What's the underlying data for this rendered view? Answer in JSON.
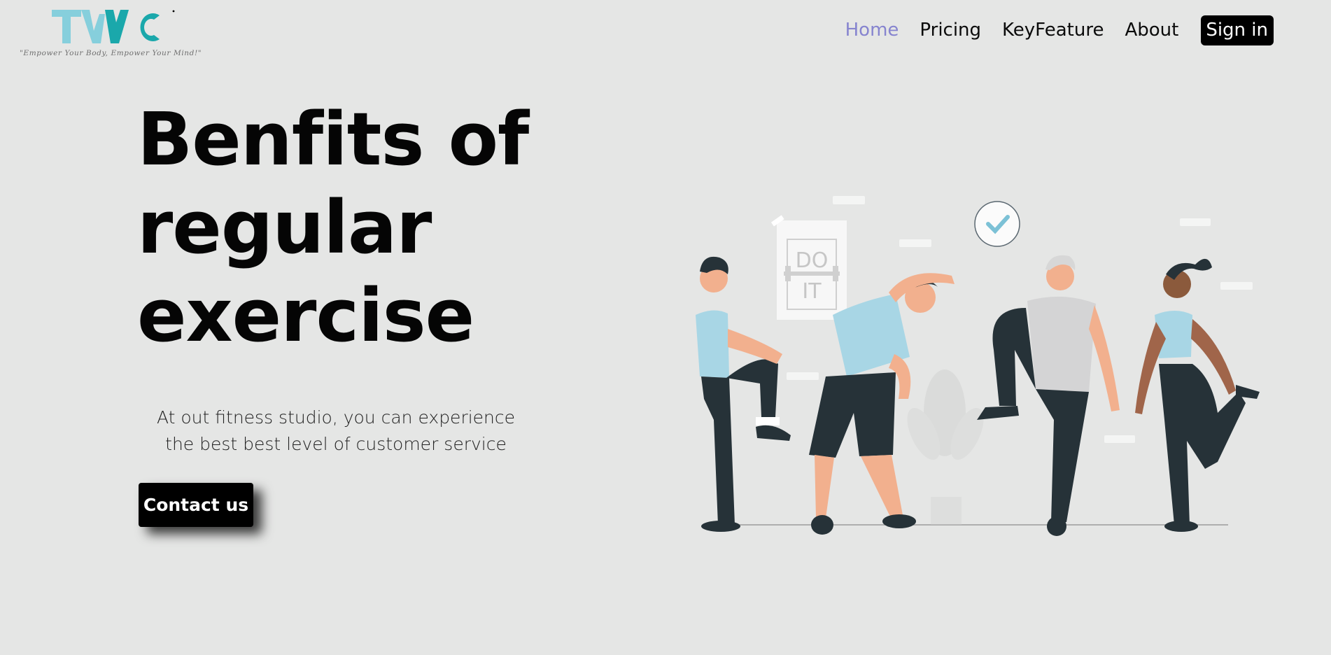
{
  "brand": {
    "logo_text": "TWC",
    "tagline": "\"Empower Your Body, Empower Your Mind!\"",
    "accent_color": "#1aa8ab",
    "accent_light": "#86cfdc"
  },
  "nav": {
    "items": [
      {
        "label": "Home",
        "active": true
      },
      {
        "label": "Pricing",
        "active": false
      },
      {
        "label": "KeyFeature",
        "active": false
      },
      {
        "label": "About",
        "active": false
      }
    ],
    "signin_label": "Sign in",
    "active_color": "#8684cf"
  },
  "hero": {
    "title_lines": [
      "Benfits of",
      "regular",
      "exercise"
    ],
    "description_lines": [
      "At out fitness studio, you can experience",
      "the best best level of customer service"
    ],
    "cta_label": "Contact us"
  },
  "illustration": {
    "poster_lines": [
      "DO",
      "IT"
    ],
    "icons": [
      "check-bubble-icon",
      "do-it-poster",
      "plant-pot"
    ]
  }
}
